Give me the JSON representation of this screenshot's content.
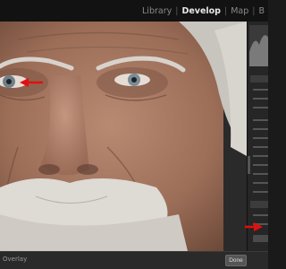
{
  "modules": {
    "library": "Library",
    "develop": "Develop",
    "map": "Map",
    "book": "B"
  },
  "toolbar": {
    "overlay_label": "Overlay",
    "done_label": "Done"
  },
  "colors": {
    "annotation_arrow": "#e01010",
    "top_bar": "#121212",
    "panel": "#262626"
  },
  "icons": {
    "arrow_eye": "red-arrow-icon",
    "arrow_panel": "red-arrow-icon"
  }
}
